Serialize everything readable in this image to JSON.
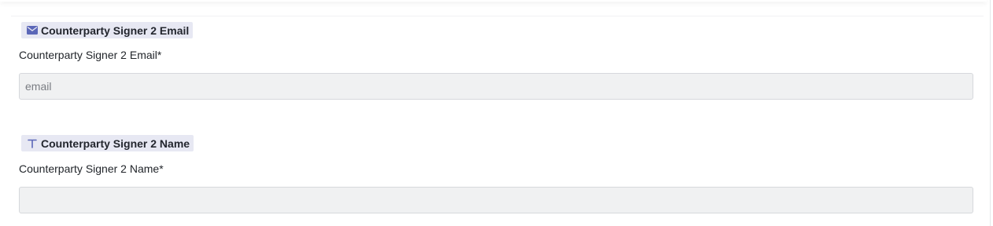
{
  "fields": [
    {
      "tag_label": "Counterparty Signer 2 Email",
      "tag_icon": "email-icon",
      "label": "Counterparty Signer 2 Email*",
      "placeholder": "email",
      "value": ""
    },
    {
      "tag_label": "Counterparty Signer 2 Name",
      "tag_icon": "text-type-icon",
      "label": "Counterparty Signer 2 Name*",
      "placeholder": "",
      "value": ""
    }
  ],
  "colors": {
    "tag_background": "#e7e8f3",
    "icon_accent": "#5b67b8",
    "input_background": "#f0f1f2",
    "input_border": "#d6d8dc"
  }
}
